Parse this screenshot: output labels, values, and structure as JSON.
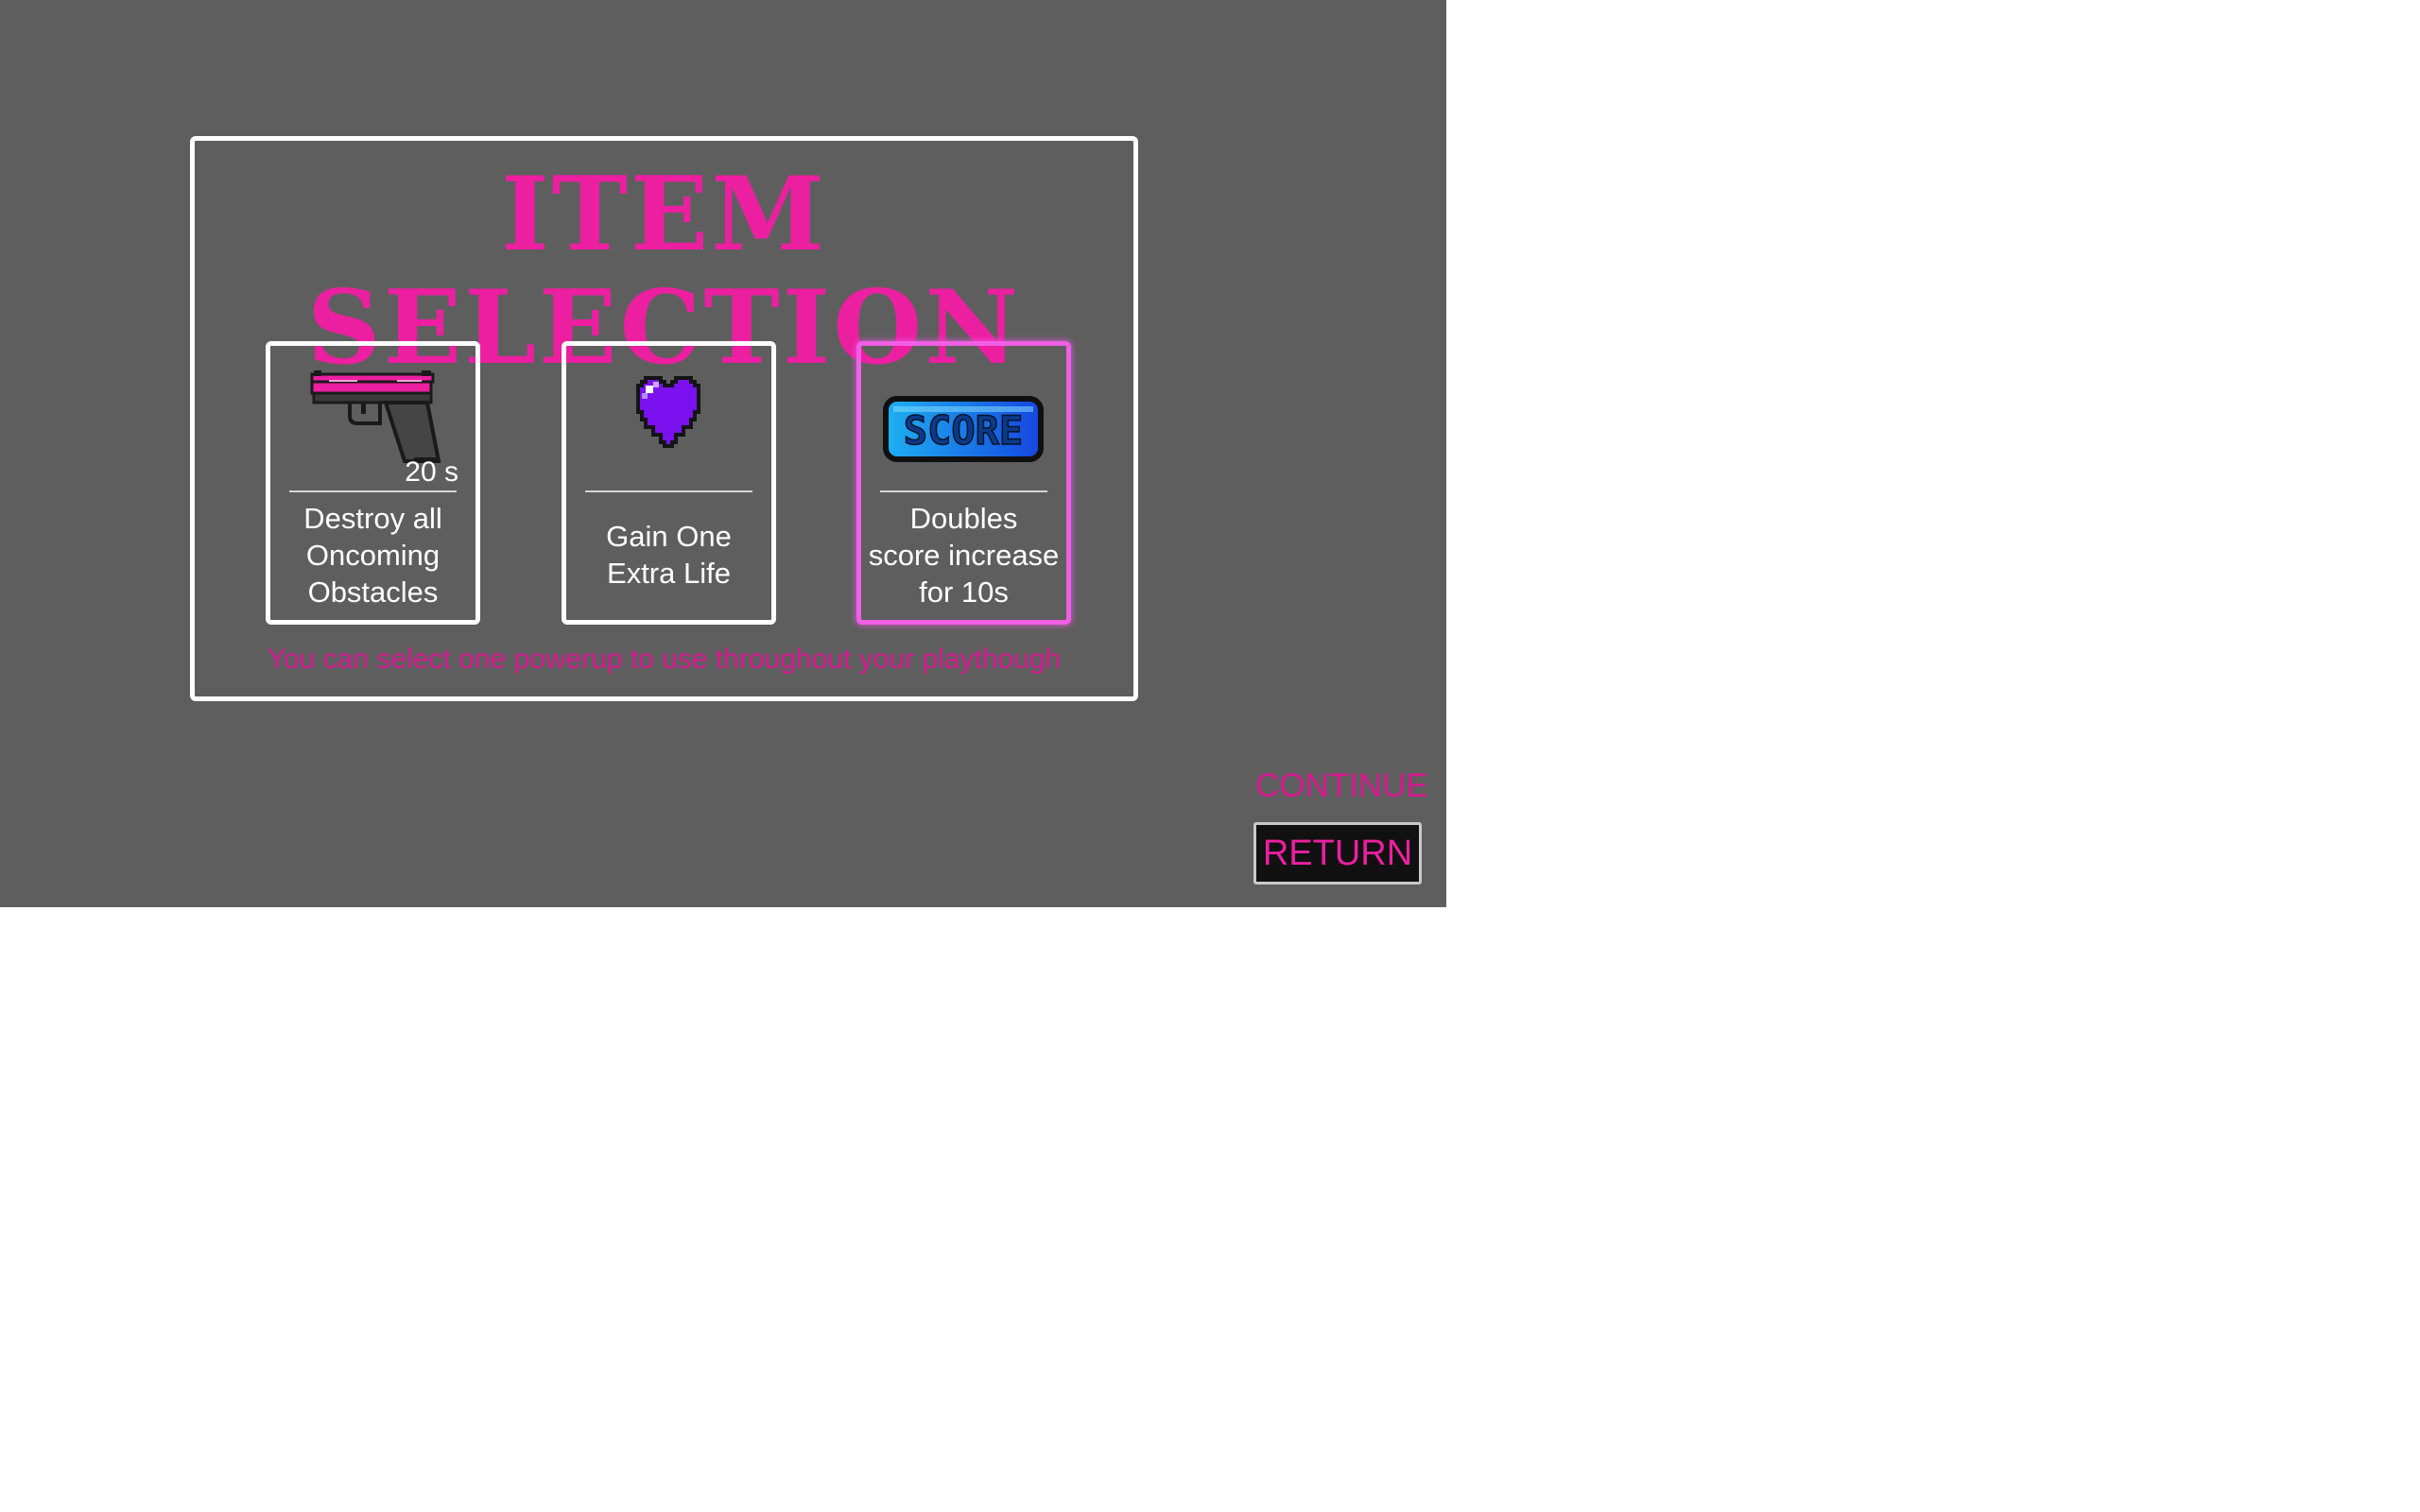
{
  "screen": {
    "background_color": "#5e5e5e",
    "title": "ITEM SELECTION",
    "hint": "You can select one powerup to use throughout your playthough"
  },
  "colors": {
    "accent": "#ec1fa1",
    "hint_text": "#d6178f",
    "selected_border": "#f15fe6"
  },
  "items": [
    {
      "icon": "pistol-icon",
      "duration": "20 s",
      "description": "Destroy all\nOncoming\nObstacles",
      "selected": false
    },
    {
      "icon": "heart-icon",
      "duration": "",
      "description": "Gain One\nExtra Life",
      "selected": false
    },
    {
      "icon": "score-badge-icon",
      "icon_text": "SCORE",
      "duration": "",
      "description": "Doubles\nscore increase\nfor 10s",
      "selected": true
    }
  ],
  "buttons": {
    "continue": "CONTINUE",
    "return": "RETURN"
  }
}
